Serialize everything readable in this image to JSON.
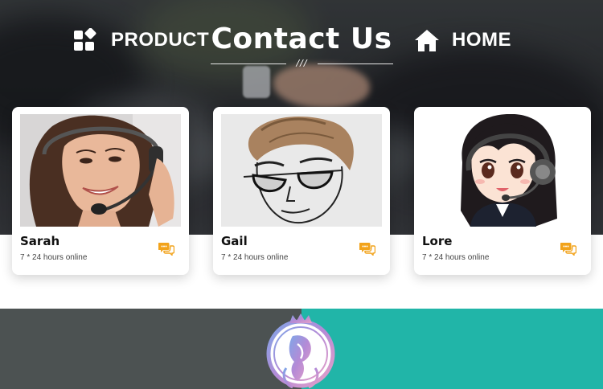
{
  "header": {
    "title": "Contact Us",
    "divider_mark": "///"
  },
  "agents": [
    {
      "name": "Sarah",
      "status": "7 * 24 hours online",
      "avatar": "woman-headset-photo",
      "action_icon": "chat-bubbles-icon"
    },
    {
      "name": "Gail",
      "status": "7 * 24 hours online",
      "avatar": "man-sunglasses-sketch",
      "action_icon": "chat-bubbles-icon"
    },
    {
      "name": "Lore",
      "status": "7 * 24 hours online",
      "avatar": "anime-girl-headset",
      "action_icon": "chat-bubbles-icon"
    }
  ],
  "bottom_nav": {
    "product_label": "PRODUCT",
    "product_icon": "grid-blocks-icon",
    "home_label": "HOME",
    "home_icon": "house-icon",
    "logo": "queen-crown-logo"
  },
  "colors": {
    "accent_chat": "#f2a31b",
    "nav_left_bg": "#4c5252",
    "nav_right_bg": "#21b5a8",
    "card_bg": "#ffffff",
    "title_text": "#ffffff"
  }
}
